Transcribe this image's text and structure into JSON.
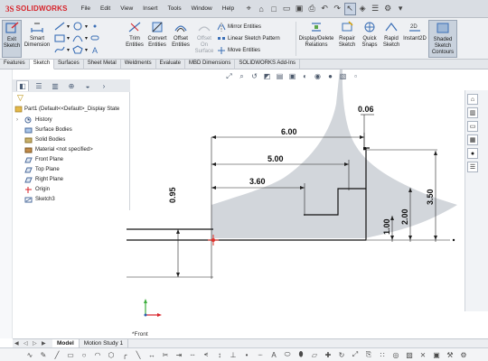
{
  "app": {
    "brand_prefix": "3S",
    "brand_name": "SOLIDWORKS"
  },
  "menu": [
    "File",
    "Edit",
    "View",
    "Insert",
    "Tools",
    "Window",
    "Help"
  ],
  "ribbon": {
    "exit_sketch": "Exit Sketch",
    "smart_dimension": "Smart Dimension",
    "trim_entities": "Trim Entities",
    "convert_entities": "Convert Entities",
    "offset_entities": "Offset Entities",
    "offset_on_surface": "Offset On Surface",
    "mirror_entities": "Mirror Entities",
    "linear_pattern": "Linear Sketch Pattern",
    "move_entities": "Move Entities",
    "display_delete_relations": "Display/Delete Relations",
    "repair_sketch": "Repair Sketch",
    "quick_snaps": "Quick Snaps",
    "rapid_sketch": "Rapid Sketch",
    "instant2d": "Instant2D",
    "shaded_sketch_contours": "Shaded Sketch Contours"
  },
  "cm_tabs": [
    "Features",
    "Sketch",
    "Surfaces",
    "Sheet Metal",
    "Weldments",
    "Evaluate",
    "MBD Dimensions",
    "SOLIDWORKS Add-Ins"
  ],
  "cm_active_tab": "Sketch",
  "feature_tree": {
    "root": "Part1  (Default<<Default>_Display State",
    "items": [
      {
        "label": "History",
        "icon": "history-icon",
        "expandable": true
      },
      {
        "label": "Surface Bodies",
        "icon": "surface-bodies-icon",
        "expandable": false
      },
      {
        "label": "Solid Bodies",
        "icon": "solid-bodies-icon",
        "expandable": false
      },
      {
        "label": "Material <not specified>",
        "icon": "material-icon",
        "expandable": false
      },
      {
        "label": "Front Plane",
        "icon": "plane-icon",
        "expandable": false
      },
      {
        "label": "Top Plane",
        "icon": "plane-icon",
        "expandable": false
      },
      {
        "label": "Right Plane",
        "icon": "plane-icon",
        "expandable": false
      },
      {
        "label": "Origin",
        "icon": "origin-icon",
        "expandable": false
      },
      {
        "label": "Sketch3",
        "icon": "sketch-icon",
        "expandable": false
      }
    ]
  },
  "dimensions": {
    "d600": "6.00",
    "d500": "5.00",
    "d360": "3.60",
    "d006": "0.06",
    "d095": "0.95",
    "d100": "1.00",
    "d200": "2.00",
    "d350": "3.50"
  },
  "view": {
    "name": "*Front"
  },
  "bottom_tabs": [
    "Model",
    "Motion Study 1"
  ],
  "bottom_active_tab": "Model",
  "colors": {
    "accent": "#d8232a",
    "sketch_line": "#000000",
    "shading": "#c9ced6",
    "origin": "#e0302a"
  }
}
